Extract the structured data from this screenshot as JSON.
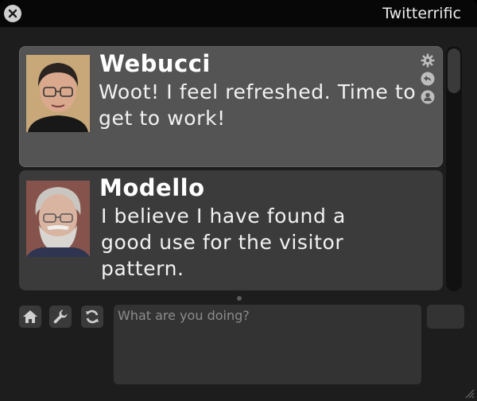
{
  "window": {
    "title": "Twitterrific"
  },
  "tweets": [
    {
      "user": "Webucci",
      "text": "Woot!  I feel refreshed. Time to get to work!",
      "selected": true,
      "actions": [
        "gear-icon",
        "reply-icon",
        "profile-icon"
      ]
    },
    {
      "user": "Modello",
      "text": "I believe I have found a good use for the visitor pattern.",
      "selected": false
    }
  ],
  "toolbar": {
    "buttons": [
      "home-icon",
      "wrench-icon",
      "refresh-icon"
    ]
  },
  "compose": {
    "placeholder": "What are you doing?",
    "value": ""
  },
  "counter": {
    "value": ""
  },
  "colors": {
    "background": "#1d1d1d",
    "titlebar": "#070707",
    "selected_tweet": "#545454",
    "tweet": "#3e3e3e"
  }
}
